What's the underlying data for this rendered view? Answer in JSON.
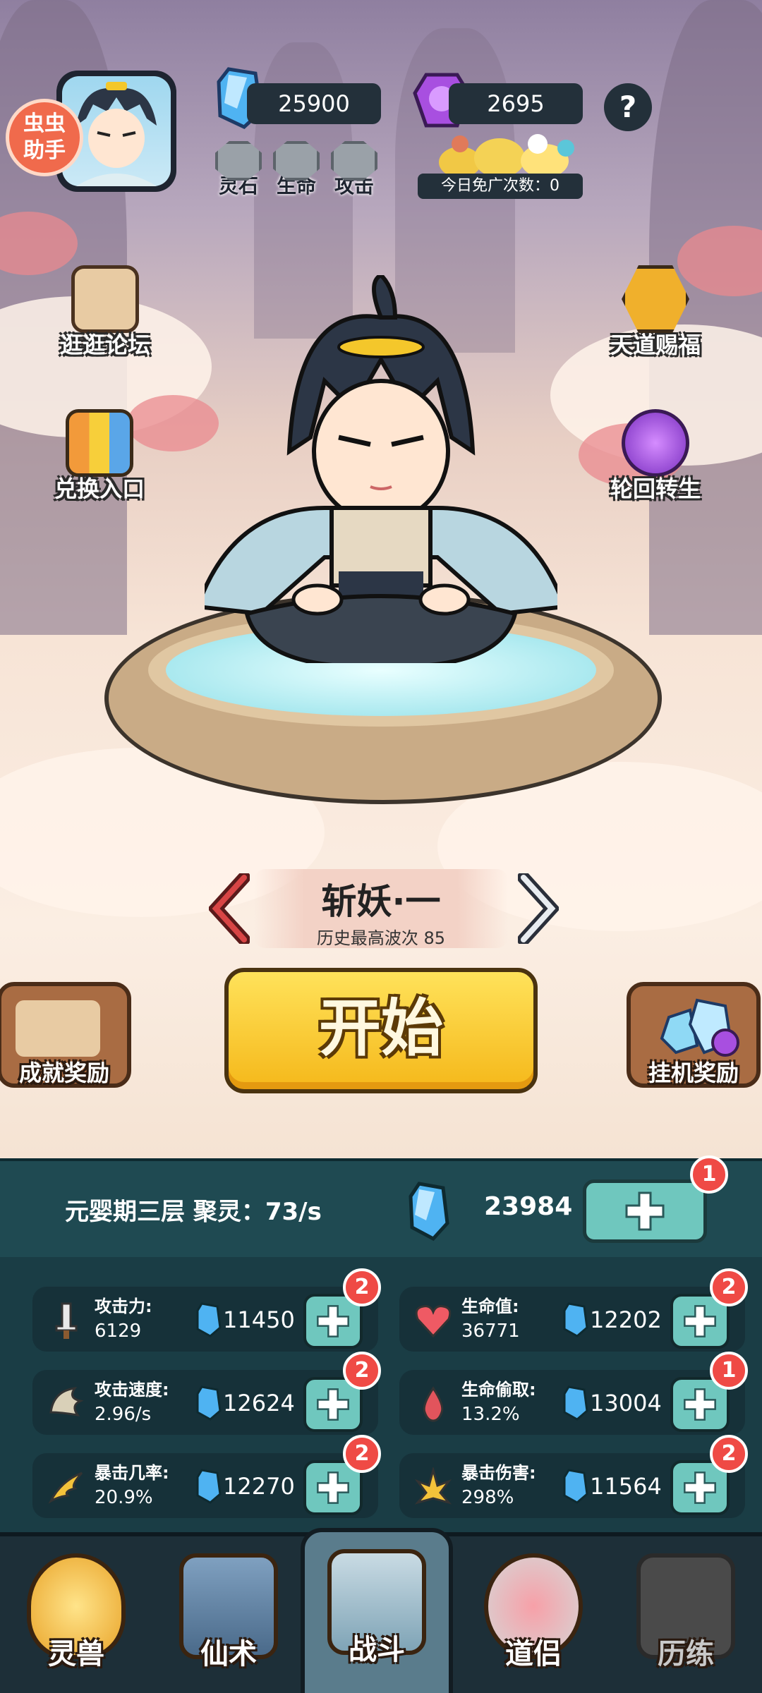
{
  "player": {
    "helper_label": "虫虫\n助手"
  },
  "currency": {
    "spirit_stones": "25900",
    "purple_gems": "2695",
    "help": "?"
  },
  "quick_stats": [
    "灵石",
    "生命",
    "攻击"
  ],
  "free_ads": "今日免广次数：0",
  "side_entries": {
    "forum": "逛逛论坛",
    "exchange": "兑换入口",
    "blessing": "天道赐福",
    "rebirth": "轮回转生"
  },
  "stage": {
    "title": "斩妖·一",
    "best_wave": "历史最高波次 85"
  },
  "start_label": "开始",
  "rewards": {
    "achievement": "成就奖励",
    "idle": "挂机奖励"
  },
  "cultivation": {
    "label": "元婴期三层 聚灵：73/s",
    "stones": "23984",
    "badge": "1"
  },
  "stats": [
    {
      "name": "攻击力:",
      "value": "6129",
      "cost": "11450",
      "badge": "2",
      "icon": "sword-icon"
    },
    {
      "name": "生命值:",
      "value": "36771",
      "cost": "12202",
      "badge": "2",
      "icon": "heart-icon"
    },
    {
      "name": "攻击速度:",
      "value": "2.96/s",
      "cost": "12624",
      "badge": "2",
      "icon": "wing-icon"
    },
    {
      "name": "生命偷取:",
      "value": "13.2%",
      "cost": "13004",
      "badge": "1",
      "icon": "blood-drop-icon"
    },
    {
      "name": "暴击几率:",
      "value": "20.9%",
      "cost": "12270",
      "badge": "2",
      "icon": "claw-icon"
    },
    {
      "name": "暴击伤害:",
      "value": "298%",
      "cost": "11564",
      "badge": "2",
      "icon": "burst-icon"
    }
  ],
  "nav": [
    "灵兽",
    "仙术",
    "战斗",
    "道侣",
    "历练"
  ],
  "colors": {
    "panel": "#1a3d45",
    "accent_button": "#6fc7be",
    "badge": "#ef4a45",
    "start": "#f5b81a"
  }
}
